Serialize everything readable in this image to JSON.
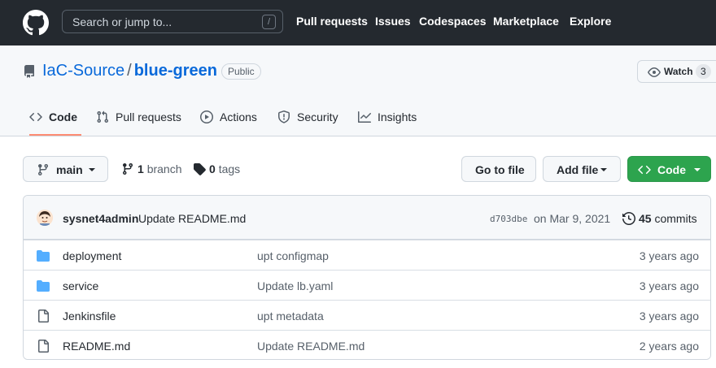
{
  "header": {
    "search_placeholder": "Search or jump to...",
    "slash_key": "/",
    "nav": [
      "Pull requests",
      "Issues",
      "Codespaces",
      "Marketplace",
      "Explore"
    ]
  },
  "repo": {
    "owner": "IaC-Source",
    "separator": "/",
    "name": "blue-green",
    "visibility": "Public",
    "watch_label": "Watch",
    "watch_count": "3"
  },
  "tabs": [
    {
      "label": "Code",
      "icon": "code-icon",
      "active": true
    },
    {
      "label": "Pull requests",
      "icon": "pull-request-icon",
      "active": false
    },
    {
      "label": "Actions",
      "icon": "play-icon",
      "active": false
    },
    {
      "label": "Security",
      "icon": "shield-icon",
      "active": false
    },
    {
      "label": "Insights",
      "icon": "graph-icon",
      "active": false
    }
  ],
  "toolbar": {
    "branch": "main",
    "branches_count": "1",
    "branches_label": "branch",
    "tags_count": "0",
    "tags_label": "tags",
    "go_to_file": "Go to file",
    "add_file": "Add file",
    "code": "Code"
  },
  "latest_commit": {
    "author": "sysnet4admin",
    "message": "Update README.md",
    "sha": "d703dbe",
    "date": "on Mar 9, 2021",
    "commits_count": "45",
    "commits_label": "commits"
  },
  "files": [
    {
      "type": "folder",
      "name": "deployment",
      "message": "upt configmap",
      "age": "3 years ago"
    },
    {
      "type": "folder",
      "name": "service",
      "message": "Update lb.yaml",
      "age": "3 years ago"
    },
    {
      "type": "file",
      "name": "Jenkinsfile",
      "message": "upt metadata",
      "age": "3 years ago"
    },
    {
      "type": "file",
      "name": "README.md",
      "message": "Update README.md",
      "age": "2 years ago"
    }
  ],
  "colors": {
    "header_bg": "#24292f",
    "link": "#0969da",
    "primary_button": "#2da44e",
    "active_tab_underline": "#fd8c73",
    "folder_icon": "#54aeff"
  }
}
